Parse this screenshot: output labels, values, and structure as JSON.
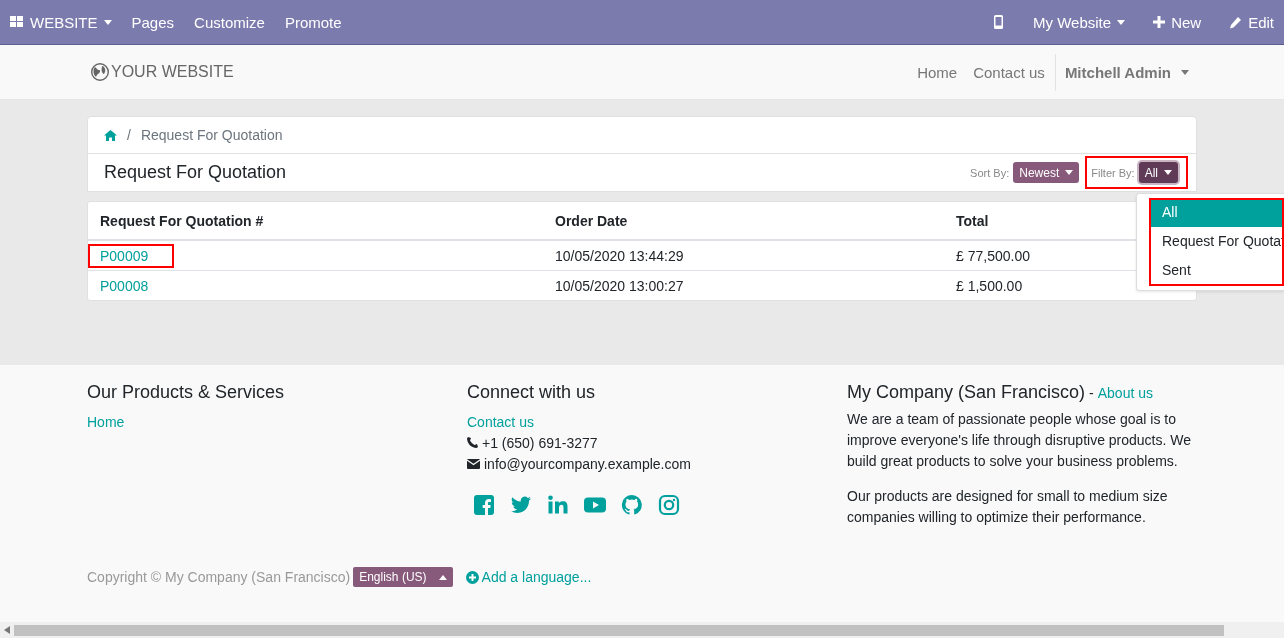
{
  "top_bar": {
    "apps_menu": "WEBSITE",
    "menu": [
      "Pages",
      "Customize",
      "Promote"
    ],
    "website_switcher": "My Website",
    "new_button": "New",
    "edit_button": "Edit"
  },
  "header": {
    "logo": "YOUR WEBSITE",
    "nav": [
      "Home",
      "Contact us"
    ],
    "user_menu": "Mitchell Admin"
  },
  "breadcrumb": {
    "separator": "/",
    "current": "Request For Quotation"
  },
  "page_title": "Request For Quotation",
  "sort": {
    "label": "Sort By:",
    "value": "Newest"
  },
  "filter": {
    "label": "Filter By:",
    "value": "All",
    "highlighted": true,
    "expanded": true,
    "options_highlighted": true,
    "options": [
      {
        "label": "All",
        "selected": true
      },
      {
        "label": "Request For Quotat",
        "selected": false
      },
      {
        "label": "Sent",
        "selected": false
      }
    ]
  },
  "table": {
    "columns": [
      "Request For Quotation #",
      "Order Date",
      "Total"
    ],
    "rows": [
      {
        "number": "P00009",
        "order_date": "10/05/2020 13:44:29",
        "total": "£ 77,500.00",
        "highlighted": true
      },
      {
        "number": "P00008",
        "order_date": "10/05/2020 13:00:27",
        "total": "£ 1,500.00",
        "highlighted": false
      }
    ]
  },
  "footer": {
    "products": {
      "title": "Our Products & Services",
      "links": [
        "Home"
      ]
    },
    "connect": {
      "title": "Connect with us",
      "link": "Contact us",
      "phone": "+1 (650) 691-3277",
      "email": "info@yourcompany.example.com"
    },
    "company": {
      "title": "My Company (San Francisco)",
      "dash": "-",
      "link": "About us",
      "paragraphs": [
        "We are a team of passionate people whose goal is to improve everyone's life through disruptive products. We build great products to solve your business problems.",
        "Our products are designed for small to medium size companies willing to optimize their performance."
      ]
    }
  },
  "copyright": {
    "text": "Copyright © My Company (San Francisco)",
    "language": "English (US)",
    "add_language": "Add a language..."
  }
}
